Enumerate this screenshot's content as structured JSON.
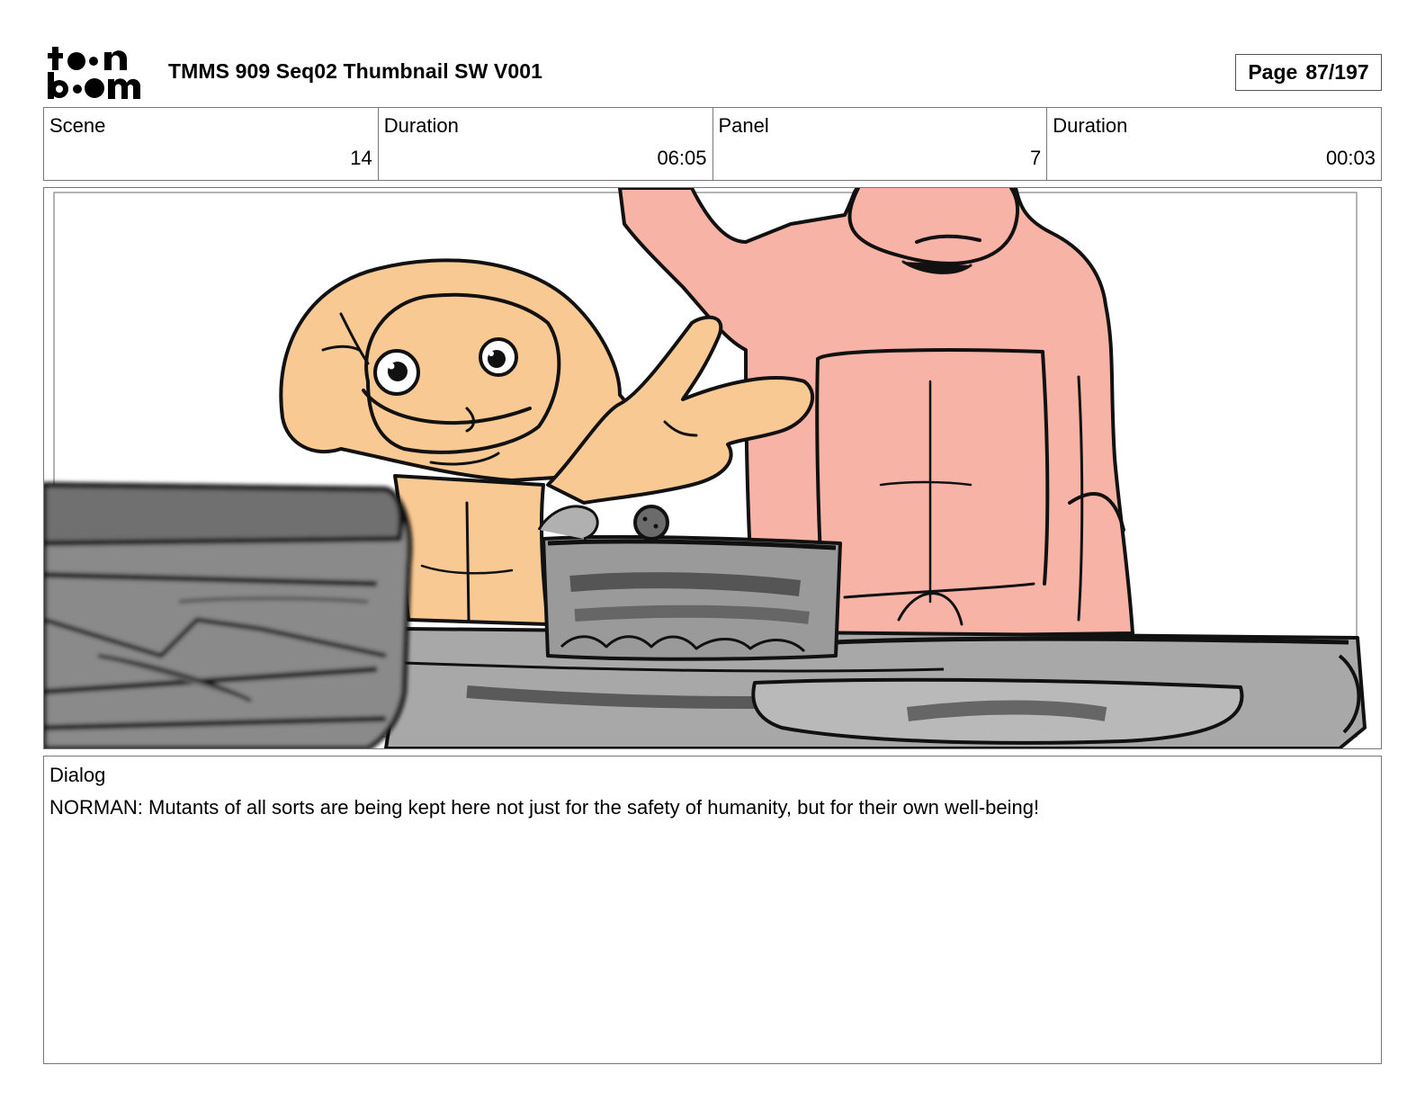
{
  "header": {
    "logo_text": "toon boom",
    "title": "TMMS 909 Seq02 Thumbnail SW V001",
    "page_label": "Page",
    "page_value": "87/197"
  },
  "info": {
    "scene_label": "Scene",
    "scene_value": "14",
    "scene_duration_label": "Duration",
    "scene_duration_value": "06:05",
    "panel_label": "Panel",
    "panel_value": "7",
    "panel_duration_label": "Duration",
    "panel_duration_value": "00:03"
  },
  "dialog": {
    "label": "Dialog",
    "text": "NORMAN: Mutants of all sorts are being kept here not just for the safety of humanity, but for their own well-being!"
  },
  "colors": {
    "orange_character": "#f9c994",
    "pink_character": "#f7b3a6",
    "grey_props": "#a8a8a8",
    "dark_grey_props": "#6b6b6b"
  }
}
